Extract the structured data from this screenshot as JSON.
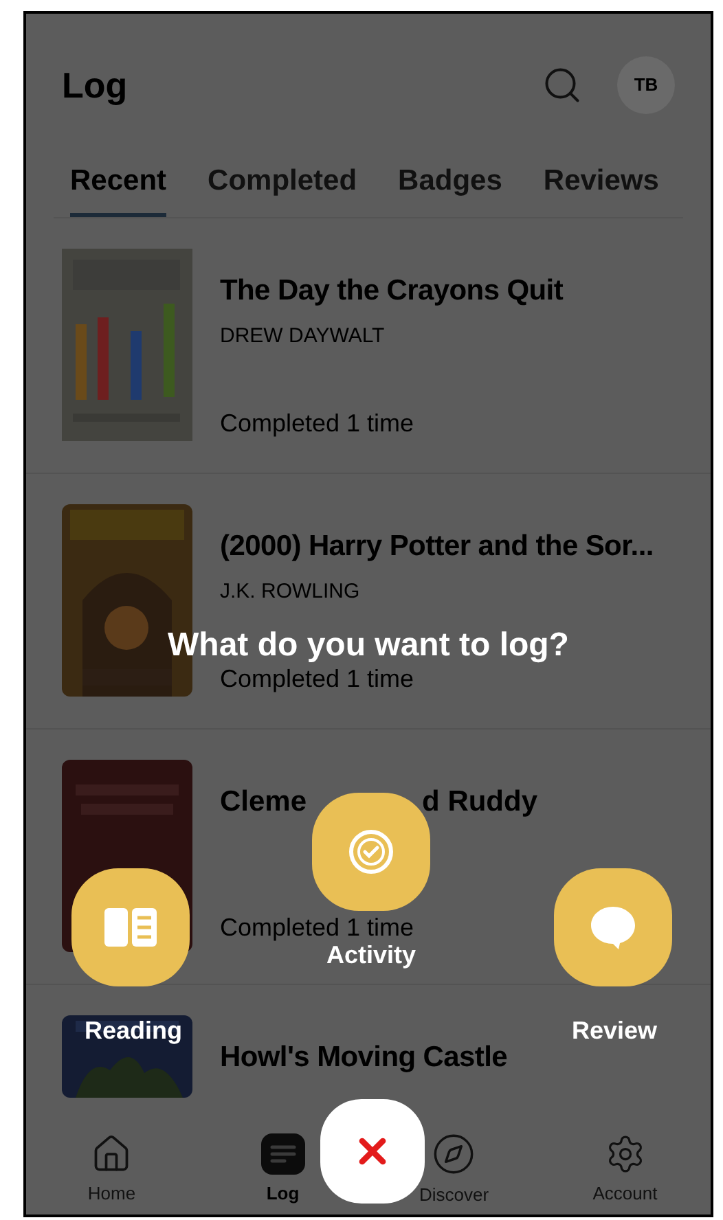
{
  "header": {
    "title": "Log",
    "avatar_initials": "TB"
  },
  "tabs": [
    {
      "label": "Recent",
      "selected": true
    },
    {
      "label": "Completed",
      "selected": false
    },
    {
      "label": "Badges",
      "selected": false
    },
    {
      "label": "Reviews",
      "selected": false
    }
  ],
  "books": [
    {
      "title": "The Day the Crayons Quit",
      "author": "DREW DAYWALT",
      "status": "Completed 1 time"
    },
    {
      "title": "(2000) Harry Potter and the Sor...",
      "author": "J.K. ROWLING",
      "status": "Completed 1 time"
    },
    {
      "title_parts": [
        "Cleme",
        "d Ruddy"
      ],
      "status": "Completed 1 time"
    },
    {
      "title": "Howl's Moving Castle"
    }
  ],
  "overlay": {
    "prompt": "What do you want to log?",
    "options": [
      {
        "kind": "reading",
        "label": "Reading"
      },
      {
        "kind": "activity",
        "label": "Activity"
      },
      {
        "kind": "review",
        "label": "Review"
      }
    ]
  },
  "nav": [
    {
      "kind": "home",
      "label": "Home",
      "selected": false
    },
    {
      "kind": "log",
      "label": "Log",
      "selected": true
    },
    {
      "kind": "discover",
      "label": "Discover",
      "selected": false
    },
    {
      "kind": "account",
      "label": "Account",
      "selected": false
    }
  ]
}
